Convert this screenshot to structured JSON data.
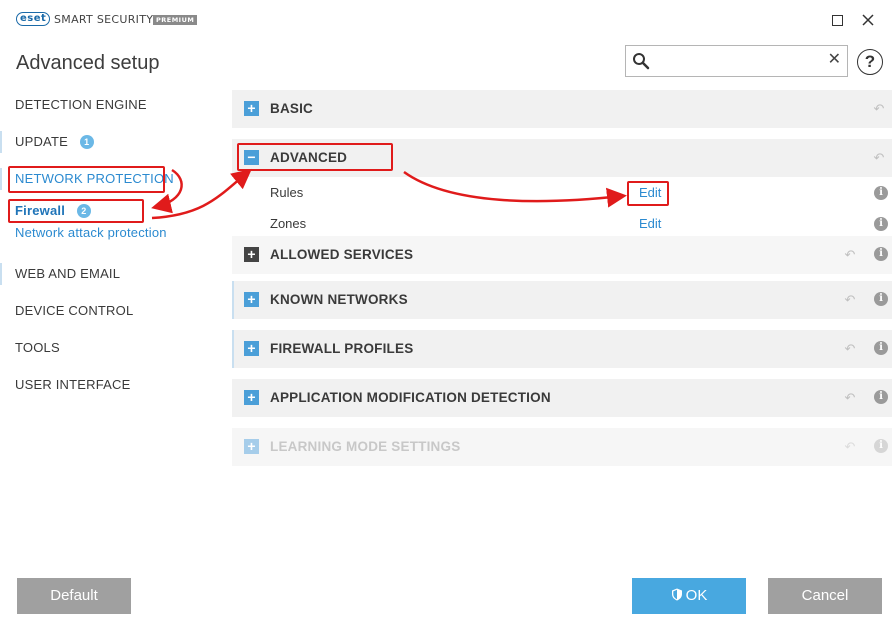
{
  "window": {
    "logo_text": "eset",
    "product_name": "SMART SECURITY",
    "edition": "PREMIUM",
    "maximize_icon": "maximize-icon",
    "close_icon": "close-icon"
  },
  "header": {
    "title": "Advanced setup",
    "search": {
      "value": "",
      "placeholder": ""
    },
    "help_label": "?"
  },
  "sidebar": {
    "items": [
      {
        "label": "DETECTION ENGINE"
      },
      {
        "label": "UPDATE",
        "badge": "1"
      },
      {
        "label": "NETWORK PROTECTION"
      },
      {
        "label": "Firewall",
        "badge": "2"
      },
      {
        "label": "Network attack protection"
      },
      {
        "label": "WEB AND EMAIL"
      },
      {
        "label": "DEVICE CONTROL"
      },
      {
        "label": "TOOLS"
      },
      {
        "label": "USER INTERFACE"
      }
    ]
  },
  "main": {
    "sections": [
      {
        "title": "BASIC",
        "toggle": "+",
        "expanded": false
      },
      {
        "title": "ADVANCED",
        "toggle": "−",
        "expanded": true,
        "rows": [
          {
            "label": "Rules",
            "action": "Edit"
          },
          {
            "label": "Zones",
            "action": "Edit"
          }
        ]
      },
      {
        "title": "ALLOWED SERVICES",
        "toggle": "+",
        "expanded": false
      },
      {
        "title": "KNOWN NETWORKS",
        "toggle": "+",
        "expanded": false
      },
      {
        "title": "FIREWALL PROFILES",
        "toggle": "+",
        "expanded": false
      },
      {
        "title": "APPLICATION MODIFICATION DETECTION",
        "toggle": "+",
        "expanded": false
      },
      {
        "title": "LEARNING MODE SETTINGS",
        "toggle": "+",
        "expanded": false,
        "disabled": true
      }
    ],
    "info_glyph": "i",
    "revert_glyph": "↶"
  },
  "footer": {
    "default_label": "Default",
    "ok_label": "OK",
    "cancel_label": "Cancel"
  },
  "colors": {
    "accent_blue": "#2b8ad0",
    "toggle_blue": "#4b9fd8",
    "ok_button": "#48a8e0",
    "gray_button": "#a0a0a0",
    "annotation_red": "#e01b1b",
    "section_bg": "#f1f1f1"
  }
}
